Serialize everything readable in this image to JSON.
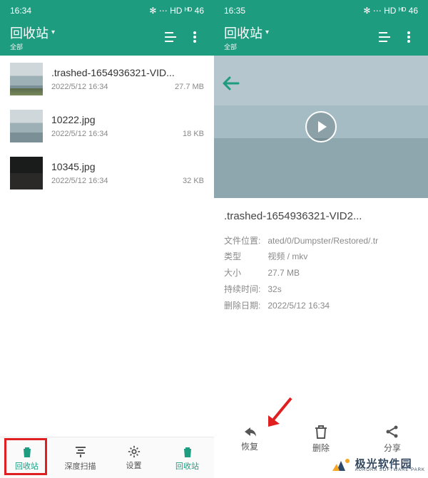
{
  "left": {
    "status_time": "16:34",
    "status_icons": "✻ ⋯ HD ᴴᴰ 46",
    "header_title": "回收站",
    "header_sub": "全部",
    "items": [
      {
        "name": ".trashed-1654936321-VID...",
        "date": "2022/5/12 16:34",
        "size": "27.7 MB"
      },
      {
        "name": "10222.jpg",
        "date": "2022/5/12 16:34",
        "size": "18 KB"
      },
      {
        "name": "10345.jpg",
        "date": "2022/5/12 16:34",
        "size": "32 KB"
      }
    ],
    "nav": [
      "回收站",
      "深度扫描",
      "设置",
      "回收站"
    ]
  },
  "right": {
    "status_time": "16:35",
    "status_icons": "✻ ⋯ HD ᴴᴰ 46",
    "header_title": "回收站",
    "header_sub": "全部",
    "file_title": ".trashed-1654936321-VID2...",
    "detail_labels": {
      "loc": "文件位置:",
      "type": "类型",
      "size": "大小",
      "dur": "持续时间:",
      "del": "删除日期:"
    },
    "detail_values": {
      "loc": "ated/0/Dumpster/Restored/.tr",
      "type": "视频 / mkv",
      "size": "27.7 MB",
      "dur": "32s",
      "del": "2022/5/12 16:34"
    },
    "actions": [
      "恢复",
      "删除",
      "分享"
    ]
  },
  "watermark": {
    "main": "极光软件园",
    "sub": "AURORA SOFTWARE PARK"
  }
}
